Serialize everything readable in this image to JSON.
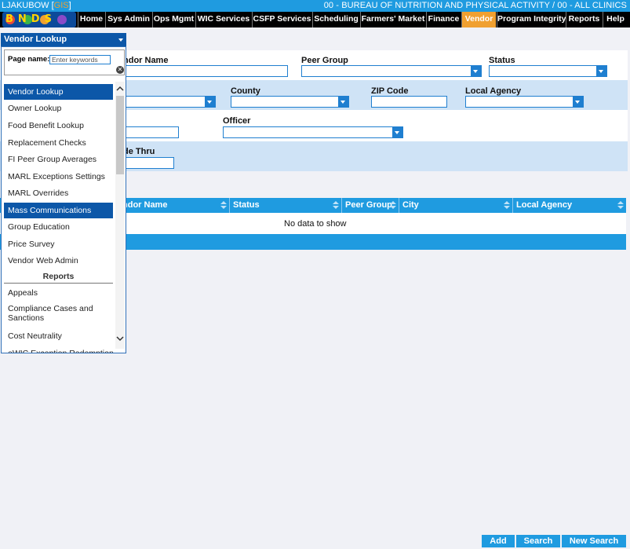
{
  "topbar": {
    "user": "LJAKUBOW",
    "user_bracket_open": "[",
    "user_extra": "GIS",
    "user_bracket_close": "]",
    "agency": "00 - BUREAU OF NUTRITION AND PHYSICAL ACTIVITY / 00 - ALL CLINICS"
  },
  "logo": {
    "text": "BNDS"
  },
  "nav": [
    "Home",
    "Sys Admin",
    "Ops Mgmt",
    "WIC Services",
    "CSFP Services",
    "Scheduling",
    "Farmers' Market",
    "Finance",
    "Vendor",
    "Program Integrity",
    "Reports",
    "Help"
  ],
  "nav_active": "Vendor",
  "form": {
    "vendor_name_label": "ndor Name",
    "peer_group_label": "Peer Group",
    "status_label": "Status",
    "county_label": "County",
    "zip_label": "ZIP Code",
    "local_agency_label": "Local Agency",
    "officer_label": "Officer",
    "de_thru_label": "de Thru"
  },
  "grid": {
    "columns": [
      "ndor Name",
      "Status",
      "Peer Group",
      "City",
      "Local Agency"
    ],
    "empty": "No data to show"
  },
  "buttons": {
    "add": "Add",
    "search": "Search",
    "new_search": "New Search"
  },
  "dropdown": {
    "selected": "Vendor Lookup",
    "page_name_label": "Page name:",
    "keywords_placeholder": "Enter keywords",
    "items": [
      "Vendor Lookup",
      "Owner Lookup",
      "Food Benefit Lookup",
      "Replacement Checks",
      "FI Peer Group Averages",
      "MARL Exceptions Settings",
      "MARL Overrides",
      "Mass Communications",
      "Group Education",
      "Price Survey",
      "Vendor Web Admin"
    ],
    "reports_header": "Reports",
    "report_items": [
      "Appeals",
      "Compliance Cases and Sanctions",
      "Cost Neutrality",
      "eWIC Exception Redemption"
    ]
  },
  "colors": {
    "accent": "#1f9be0",
    "dark_blue": "#0c57a8",
    "active_nav": "#f0a030",
    "nav_bg": "#000000",
    "blue_row": "#cfe3f6"
  }
}
